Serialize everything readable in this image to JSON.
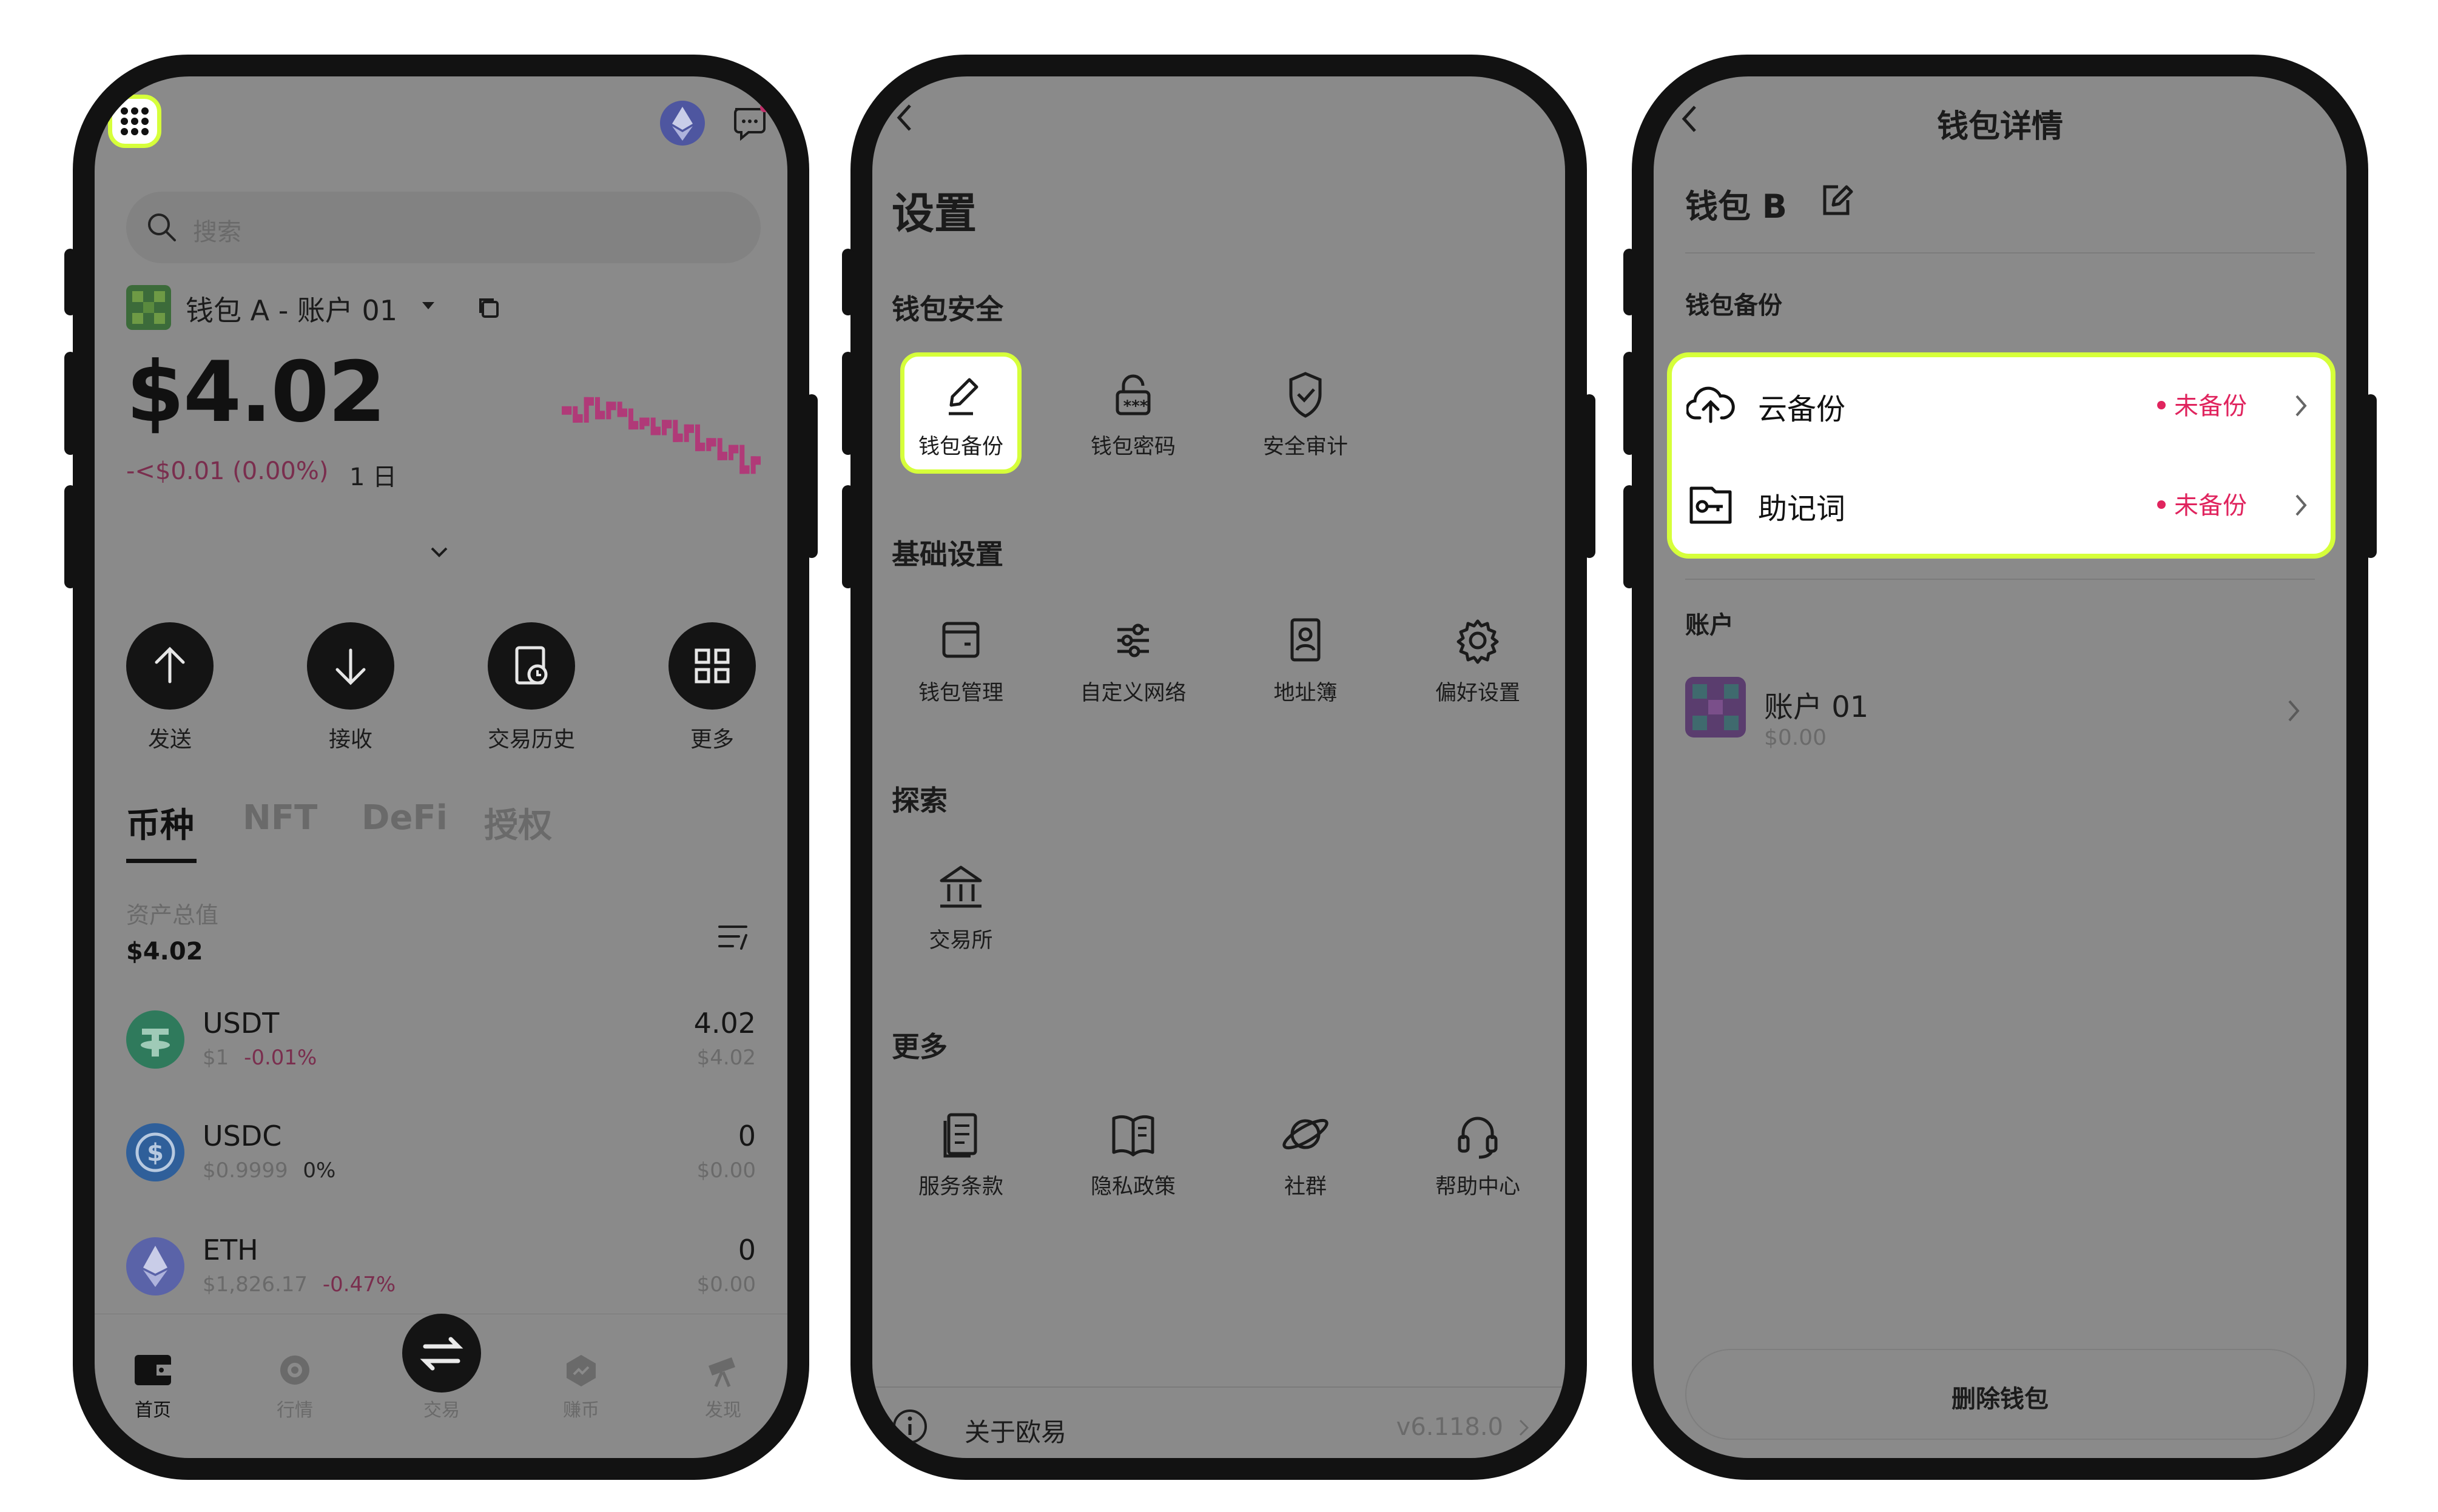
{
  "phone1": {
    "search_placeholder": "搜索",
    "account_label": "钱包 A - 账户 01",
    "balance": "$4.02",
    "change": "-<$0.01 (0.00%)",
    "period": "1 日",
    "actions": [
      "发送",
      "接收",
      "交易历史",
      "更多"
    ],
    "tabs": [
      "币种",
      "NFT",
      "DeFi",
      "授权"
    ],
    "total_label": "资产总值",
    "total_value": "$4.02",
    "tokens": [
      {
        "name": "USDT",
        "price": "$1",
        "change": "-0.01%",
        "amount": "4.02",
        "fiat": "$4.02",
        "color": "#2f7a5c"
      },
      {
        "name": "USDC",
        "price": "$0.9999",
        "change": "0%",
        "amount": "0",
        "fiat": "$0.00",
        "color": "#2f5f9a"
      },
      {
        "name": "ETH",
        "price": "$1,826.17",
        "change": "-0.47%",
        "amount": "0",
        "fiat": "$0.00",
        "color": "#5a63a8"
      }
    ],
    "nav": [
      "首页",
      "行情",
      "交易",
      "赚币",
      "发现"
    ],
    "sparkline": [
      62,
      55,
      70,
      58,
      66,
      60,
      49,
      52,
      44,
      50,
      38,
      46,
      30,
      34,
      22,
      28,
      10,
      18
    ],
    "sparkline_color": "#b03a78"
  },
  "phone2": {
    "title": "设置",
    "sections": [
      {
        "title": "钱包安全",
        "items": [
          "钱包备份",
          "钱包密码",
          "安全审计"
        ]
      },
      {
        "title": "基础设置",
        "items": [
          "钱包管理",
          "自定义网络",
          "地址簿",
          "偏好设置"
        ]
      },
      {
        "title": "探索",
        "items": [
          "交易所"
        ]
      },
      {
        "title": "更多",
        "items": [
          "服务条款",
          "隐私政策",
          "社群",
          "帮助中心"
        ]
      }
    ],
    "about_label": "关于欧易",
    "version": "v6.118.0"
  },
  "phone3": {
    "header": "钱包详情",
    "wallet_name": "钱包 B",
    "backup_section": "钱包备份",
    "backup_items": [
      {
        "label": "云备份",
        "status": "未备份"
      },
      {
        "label": "助记词",
        "status": "未备份"
      }
    ],
    "account_section": "账户",
    "account_name": "账户 01",
    "account_balance": "$0.00",
    "delete_label": "删除钱包"
  },
  "colors": {
    "highlight": "#d6ff3a",
    "status_red": "#e0245e",
    "dim_overlay": "#8a8a8a"
  }
}
